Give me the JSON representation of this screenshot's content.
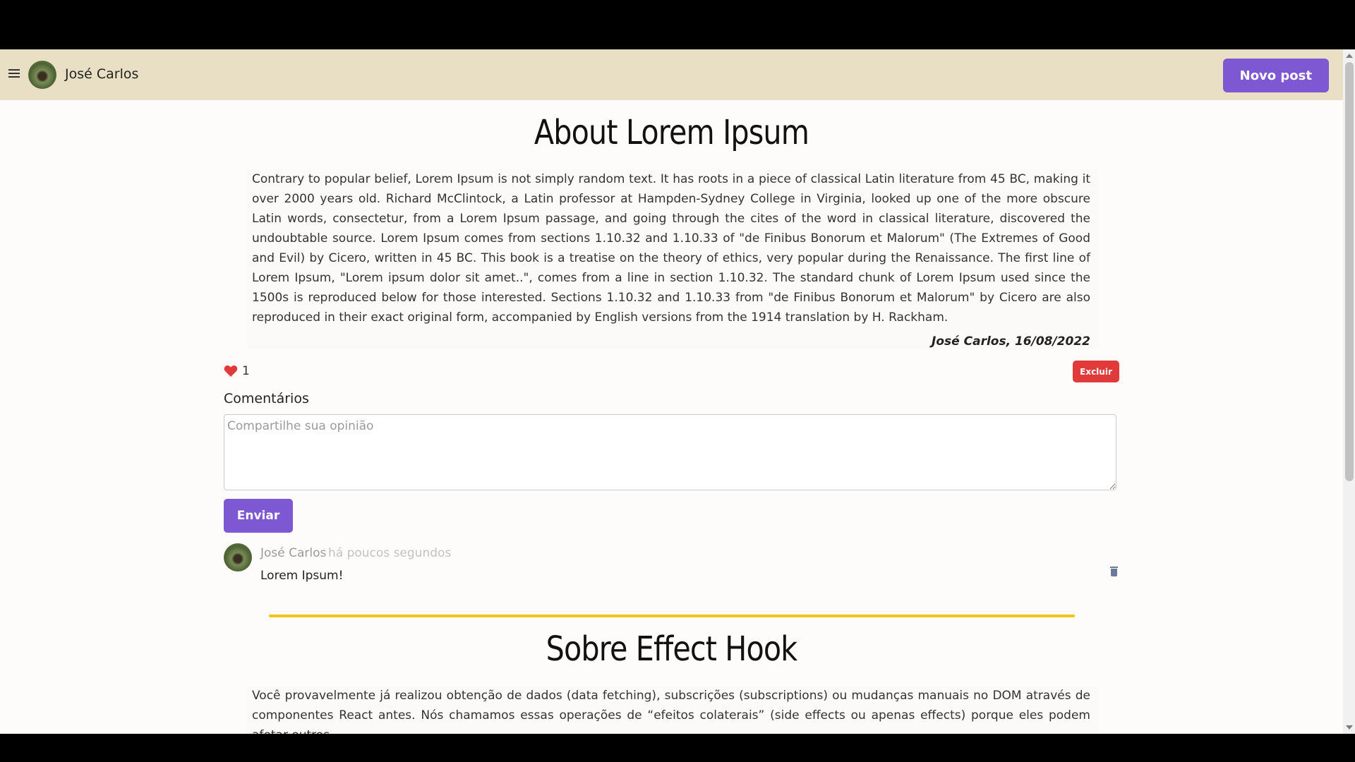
{
  "header": {
    "menu_icon": "hamburger-menu-icon",
    "user_name": "José Carlos",
    "new_post_label": "Novo post"
  },
  "posts": [
    {
      "title": "About Lorem Ipsum",
      "body": "Contrary to popular belief, Lorem Ipsum is not simply random text. It has roots in a piece of classical Latin literature from 45 BC, making it over 2000 years old. Richard McClintock, a Latin professor at Hampden-Sydney College in Virginia, looked up one of the more obscure Latin words, consectetur, from a Lorem Ipsum passage, and going through the cites of the word in classical literature, discovered the undoubtable source. Lorem Ipsum comes from sections 1.10.32 and 1.10.33 of \"de Finibus Bonorum et Malorum\" (The Extremes of Good and Evil) by Cicero, written in 45 BC. This book is a treatise on the theory of ethics, very popular during the Renaissance. The first line of Lorem Ipsum, \"Lorem ipsum dolor sit amet..\", comes from a line in section 1.10.32. The standard chunk of Lorem Ipsum used since the 1500s is reproduced below for those interested. Sections 1.10.32 and 1.10.33 from \"de Finibus Bonorum et Malorum\" by Cicero are also reproduced in their exact original form, accompanied by English versions from the 1914 translation by H. Rackham.",
      "meta": "José Carlos, 16/08/2022",
      "likes": "1",
      "delete_label": "Excluir",
      "comments_heading": "Comentários",
      "comment_placeholder": "Compartilhe sua opinião",
      "send_label": "Enviar",
      "comments": [
        {
          "author": "José Carlos",
          "time": "há poucos segundos",
          "text": "Lorem Ipsum!"
        }
      ]
    },
    {
      "title": "Sobre Effect Hook",
      "body": "Você provavelmente já realizou obtenção de dados (data fetching), subscrições (subscriptions) ou mudanças manuais no DOM através de componentes React antes. Nós chamamos essas operações de “efeitos colaterais” (side effects ou apenas effects) porque eles podem afetar outros"
    }
  ],
  "colors": {
    "accent": "#7e57d2",
    "danger": "#e03a3a",
    "header_bg": "#e8dfc4",
    "divider": "#f3c21b",
    "like": "#e03a3a"
  }
}
